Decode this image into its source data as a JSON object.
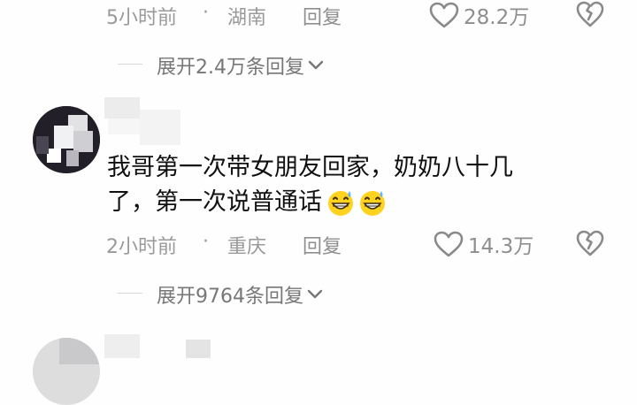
{
  "comment1": {
    "time": "5小时前",
    "dot": "·",
    "location": "湖南",
    "reply_label": "回复",
    "likes": "28.2万",
    "expand_label": "展开2.4万条回复"
  },
  "comment2": {
    "text_line1": "我哥第一次带女朋友回家，奶奶八十几",
    "text_line2": "了，第一次说普通话",
    "time": "2小时前",
    "dot": "·",
    "location": "重庆",
    "reply_label": "回复",
    "likes": "14.3万",
    "expand_label": "展开9764条回复"
  },
  "icons": {
    "like": "heart-outline-icon",
    "dislike": "broken-heart-icon",
    "expand": "chevron-down-icon",
    "emoji": "grinning-sweat-emoji-icon"
  }
}
